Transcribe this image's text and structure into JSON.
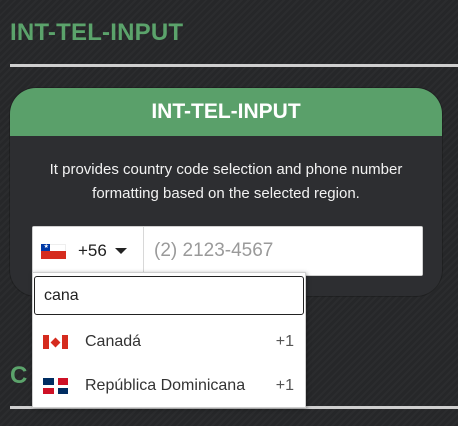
{
  "page": {
    "heading": "INT-TEL-INPUT",
    "next_section_heading_partial": "C"
  },
  "card": {
    "title": "INT-TEL-INPUT",
    "description": "It provides country code selection and phone number formatting based on the selected region."
  },
  "tel_input": {
    "selected_country_flag": "flag-cl-icon",
    "dial_code": "+56",
    "phone_placeholder": "(2) 2123-4567",
    "phone_value": ""
  },
  "dropdown": {
    "search_value": "cana",
    "countries": [
      {
        "flag": "flag-ca-icon",
        "name": "Canadá",
        "code": "+1"
      },
      {
        "flag": "flag-do-icon",
        "name": "República Dominicana",
        "code": "+1"
      }
    ]
  },
  "colors": {
    "accent": "#5aa06a",
    "background": "#262729",
    "card": "#2d2e31"
  }
}
